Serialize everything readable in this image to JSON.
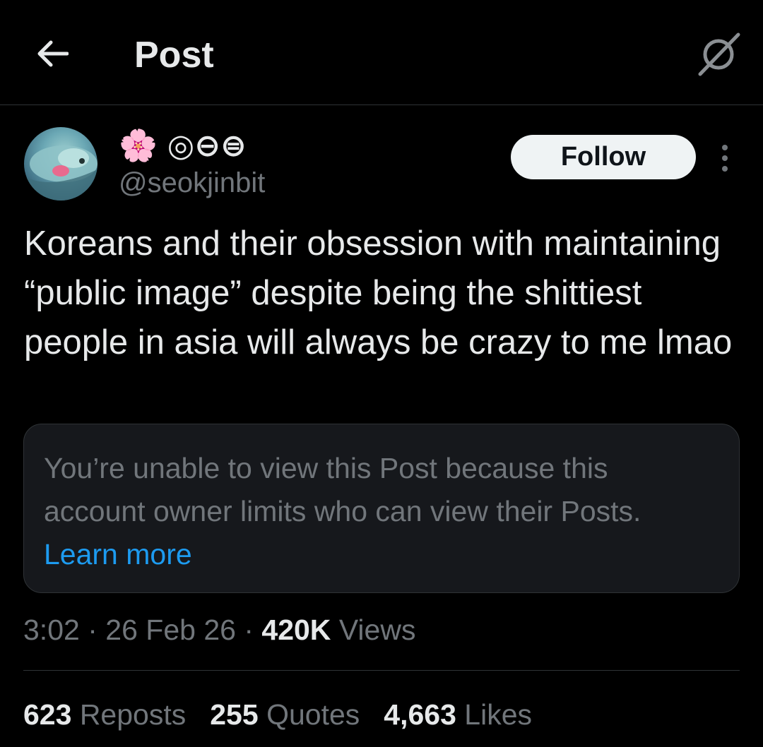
{
  "header": {
    "title": "Post",
    "back_icon": "arrow-left-icon",
    "grok_icon": "grok-icon"
  },
  "author": {
    "display_name_text": "◎⊖⊜",
    "display_name_emoji": "🌸",
    "handle": "@seokjinbit",
    "follow_label": "Follow",
    "more_icon": "more-vertical-icon"
  },
  "post": {
    "text": "Koreans and their obsession with maintaining “public image” despite being the shittiest people in asia will always be crazy to me lmao"
  },
  "quote_unavailable": {
    "message": "You’re unable to view this Post because this account owner limits who can view their Posts.",
    "link_label": "Learn more"
  },
  "meta": {
    "time": "3:02",
    "date": "26 Feb 26",
    "views_count": "420K",
    "views_label": "Views",
    "separator": "·"
  },
  "stats": {
    "reposts_count": "623",
    "reposts_label": "Reposts",
    "quotes_count": "255",
    "quotes_label": "Quotes",
    "likes_count": "4,663",
    "likes_label": "Likes"
  },
  "colors": {
    "background": "#000000",
    "text_primary": "#e7e9ea",
    "text_secondary": "#71767b",
    "accent": "#1d9bf0",
    "card_bg": "#16181c",
    "border": "#2f3336"
  }
}
